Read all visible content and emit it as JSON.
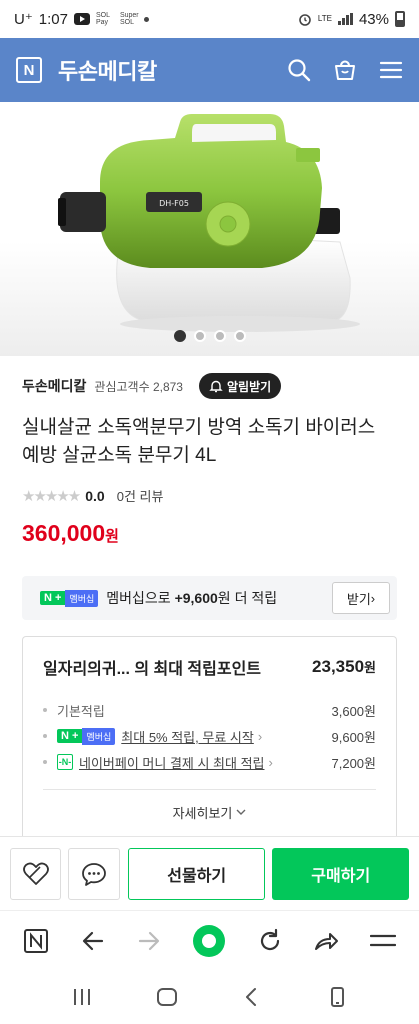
{
  "status_bar": {
    "carrier": "U⁺",
    "time": "1:07",
    "mini_text_1": "SOL Pay",
    "mini_text_2": "Super SOL",
    "network": "LTE",
    "battery": "43%"
  },
  "header": {
    "logo_letter": "N",
    "store_name": "두손메디칼"
  },
  "gallery": {
    "badge_text": "DH-F05",
    "slide_count": 4,
    "active_slide": 1
  },
  "seller": {
    "name": "두손메디칼",
    "fans": "관심고객수 2,873",
    "alarm_label": "알림받기"
  },
  "product": {
    "title": "실내살균 소독액분무기 방역 소독기 바이러스 예방 살균소독 분무기 4L",
    "rating_stars": "★★★★★",
    "rating_value": "0.0",
    "review_count": "0건 리뷰",
    "price": "360,000",
    "price_unit": "원"
  },
  "membership": {
    "badge_n": "N +",
    "badge_label": "멤버십",
    "text_prefix": "멤버십으로",
    "text_amount": "+9,600",
    "text_suffix": "원 더 적립",
    "button_label": "받기"
  },
  "points": {
    "header_label": "일자리의귀...  의 최대 적립포인트",
    "header_amount": "23,350",
    "header_unit": "원",
    "rows": [
      {
        "label": "기본적립",
        "value": "3,600원"
      },
      {
        "label": "최대 5% 적립, 무료 시작",
        "value": "9,600원"
      },
      {
        "label": "네이버페이 머니 결제 시 최대 적립",
        "value": "7,200원"
      }
    ],
    "pay_icon_text": "-N-",
    "more_label": "자세히보기"
  },
  "actions": {
    "gift_label": "선물하기",
    "buy_label": "구매하기"
  },
  "colors": {
    "header_bg": "#5a85c9",
    "naver_green": "#03c75a",
    "price_red": "#e0001b",
    "membership_blue": "#4c6ef5"
  }
}
